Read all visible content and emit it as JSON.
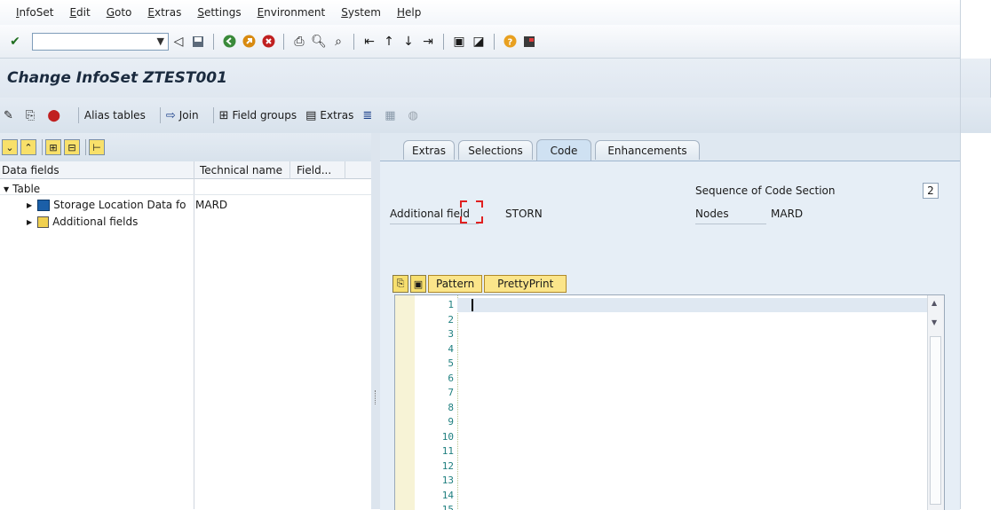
{
  "menu": [
    "InfoSet",
    "Edit",
    "Goto",
    "Extras",
    "Settings",
    "Environment",
    "System",
    "Help"
  ],
  "title": "Change InfoSet ZTEST001",
  "app_toolbar": {
    "alias_tables": "Alias tables",
    "join": "Join",
    "field_groups": "Field groups",
    "extras": "Extras"
  },
  "tree": {
    "col_data_fields": "Data fields",
    "col_technical_name": "Technical name",
    "col_field": "Field...",
    "root": "Table",
    "item1_label": "Storage Location Data fo",
    "item1_tech": "MARD",
    "item2_label": "Additional fields"
  },
  "tabs": [
    "Extras",
    "Selections",
    "Code",
    "Enhancements"
  ],
  "active_tab": "Code",
  "code": {
    "sequence_label": "Sequence of Code Section",
    "sequence_value": "2",
    "additional_field_label": "Additional field",
    "additional_field_value": "STORN",
    "nodes_label": "Nodes",
    "nodes_value": "MARD",
    "pattern_button": "Pattern",
    "prettyprint_button": "PrettyPrint",
    "line_numbers": [
      "1",
      "2",
      "3",
      "4",
      "5",
      "6",
      "7",
      "8",
      "9",
      "10",
      "11",
      "12",
      "13",
      "14",
      "15"
    ]
  }
}
